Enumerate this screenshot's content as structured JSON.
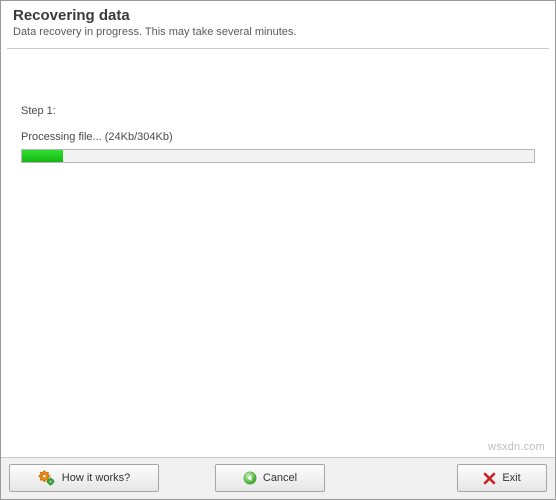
{
  "header": {
    "title": "Recovering data",
    "subtitle": "Data recovery in progress. This may take several minutes."
  },
  "content": {
    "step_label": "Step 1:",
    "processing_text": "Processing file... (24Kb/304Kb)",
    "progress_percent": 8
  },
  "footer": {
    "how_label": "How it works?",
    "cancel_label": "Cancel",
    "exit_label": "Exit"
  },
  "watermark": "wsxdn.com",
  "icons": {
    "gear": "gear-icon",
    "cancel": "cancel-icon",
    "exit": "exit-icon"
  },
  "colors": {
    "progress_fill": "#1fc41f",
    "button_bg": "#f2f2f2"
  }
}
